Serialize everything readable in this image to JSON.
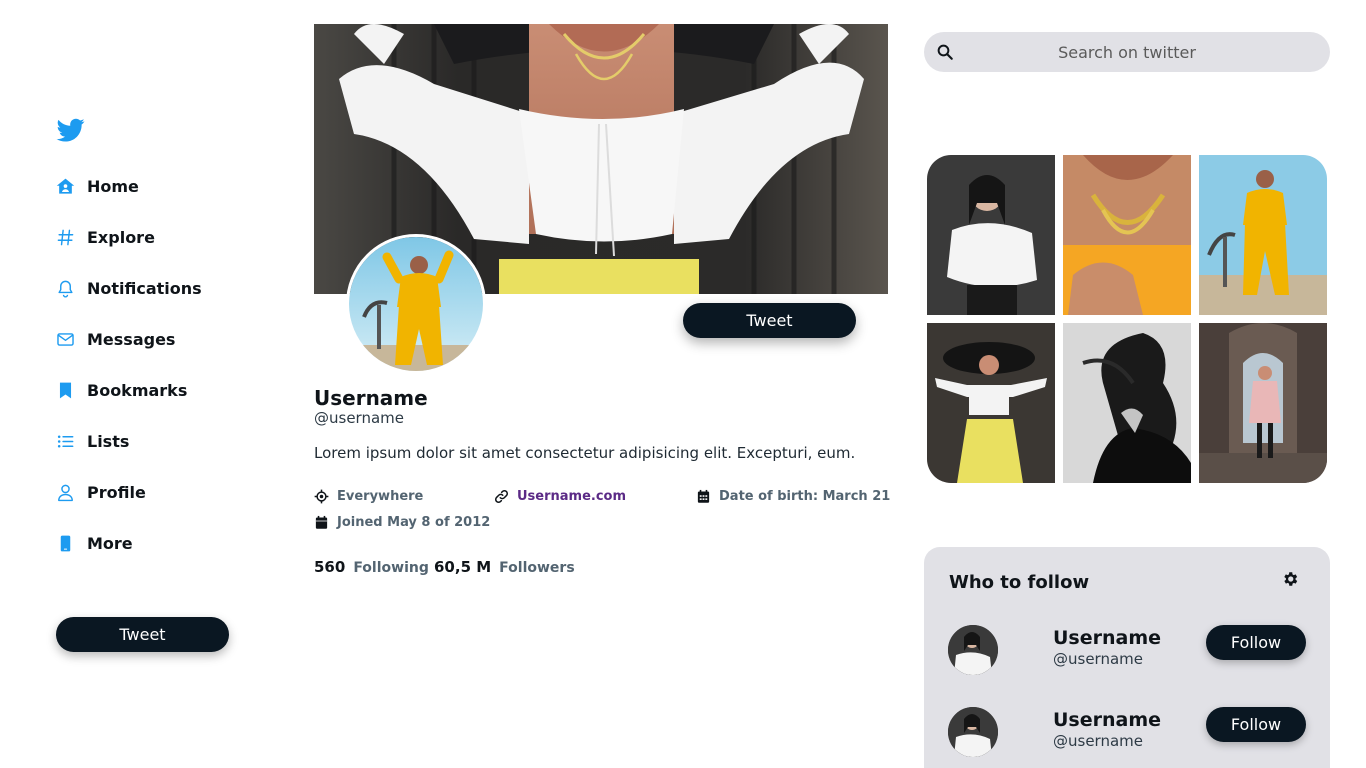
{
  "colors": {
    "accent": "#1d9bf0",
    "dark_button": "#0a1722",
    "panel": "#e1e1e6",
    "muted": "#536471",
    "link": "#5b2a86"
  },
  "sidebar": {
    "logo_icon": "twitter-bird-icon",
    "items": [
      {
        "label": "Home",
        "icon": "home-icon"
      },
      {
        "label": "Explore",
        "icon": "hashtag-icon"
      },
      {
        "label": "Notifications",
        "icon": "bell-icon"
      },
      {
        "label": "Messages",
        "icon": "envelope-icon"
      },
      {
        "label": "Bookmarks",
        "icon": "bookmark-icon"
      },
      {
        "label": "Lists",
        "icon": "list-icon"
      },
      {
        "label": "Profile",
        "icon": "user-icon"
      },
      {
        "label": "More",
        "icon": "phone-icon"
      }
    ],
    "tweet_button": "Tweet"
  },
  "profile": {
    "tweet_button": "Tweet",
    "name": "Username",
    "handle": "@username",
    "bio": "Lorem ipsum dolor sit amet consectetur adipisicing elit. Excepturi, eum.",
    "location": "Everywhere",
    "website": "Username.com",
    "birth": "Date of birth: March 21",
    "joined": "Joined May 8 of 2012",
    "following_count": "560",
    "following_label": "Following",
    "followers_count": "60,5 M",
    "followers_label": "Followers"
  },
  "search": {
    "placeholder": "Search on twitter"
  },
  "who_to_follow": {
    "title": "Who to follow",
    "users": [
      {
        "name": "Username",
        "handle": "@username",
        "button": "Follow"
      },
      {
        "name": "Username",
        "handle": "@username",
        "button": "Follow"
      }
    ]
  }
}
